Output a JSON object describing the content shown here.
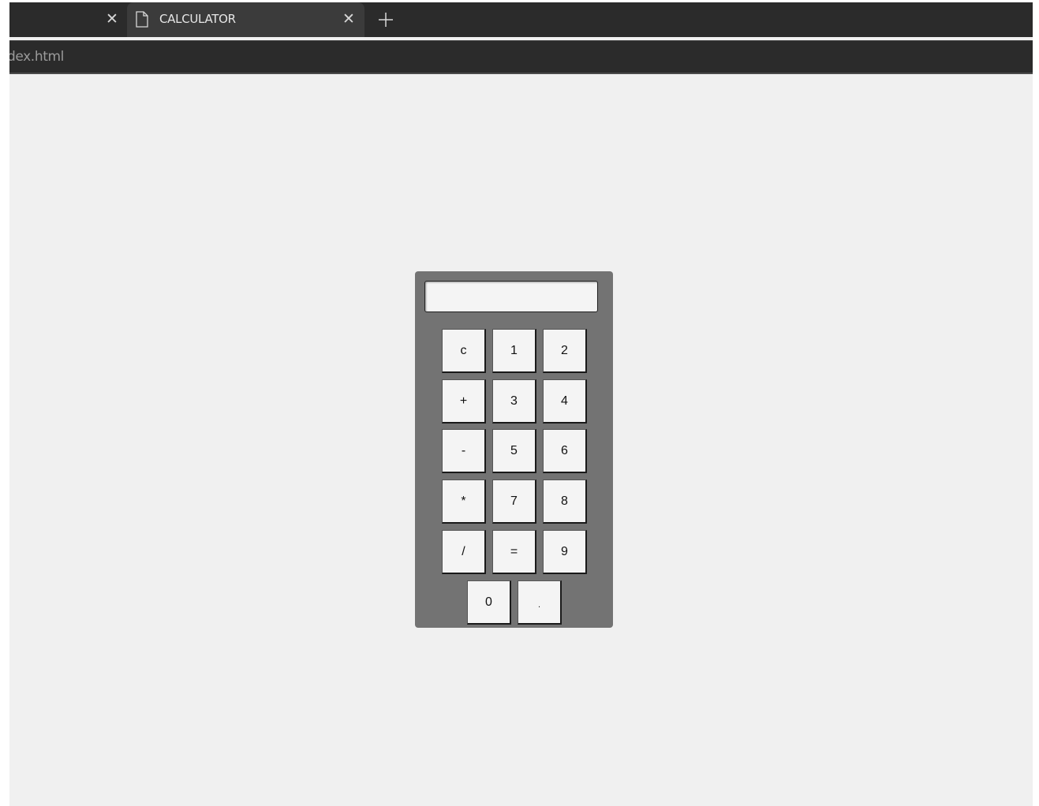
{
  "browser": {
    "tabs": [
      {
        "label": "",
        "active": false
      },
      {
        "label": "CALCULATOR",
        "active": true
      }
    ],
    "url": "dex.html"
  },
  "calculator": {
    "display_value": "",
    "keys": [
      "c",
      "1",
      "2",
      "+",
      "3",
      "4",
      "-",
      "5",
      "6",
      "*",
      "7",
      "8",
      "/",
      "=",
      "9",
      "0",
      "."
    ]
  },
  "colors": {
    "chrome": "#2b2b2b",
    "active_tab": "#3b3b3b",
    "page_bg": "#f0f0f0",
    "calc_body": "#737373",
    "key_bg": "#f4f4f4"
  }
}
